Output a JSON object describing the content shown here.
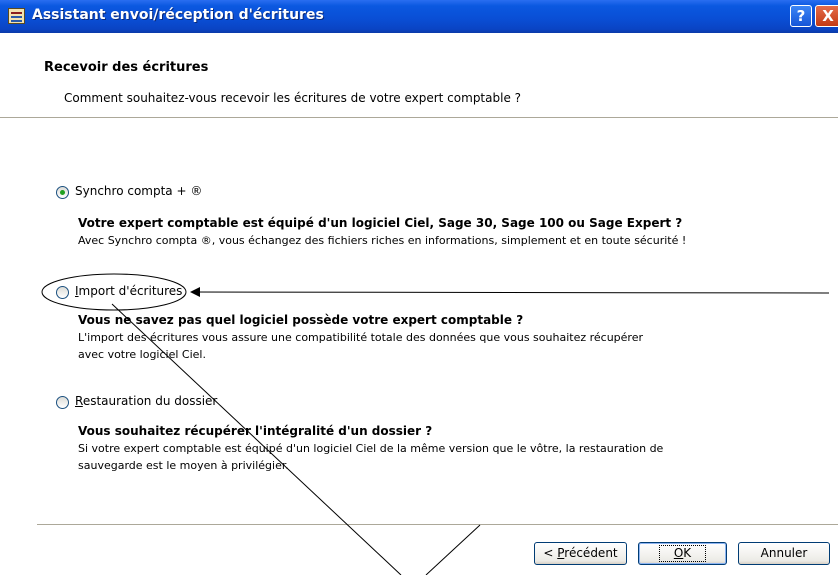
{
  "window": {
    "title": "Assistant envoi/réception d'écritures",
    "help_glyph": "?",
    "close_glyph": "X",
    "app_icon": "ledger-icon"
  },
  "header": {
    "title": "Recevoir des écritures",
    "subtitle": "Comment souhaitez-vous recevoir les écritures de votre expert comptable ?"
  },
  "options": [
    {
      "label": "Synchro compta + ®",
      "checked": true,
      "bold": "Votre expert comptable est équipé d'un logiciel Ciel, Sage 30, Sage 100 ou Sage Expert ?",
      "desc": [
        "Avec Synchro compta ®, vous échangez des fichiers riches en informations, simplement et en toute sécurité !"
      ]
    },
    {
      "label_pre": "",
      "label_accel": "I",
      "label_post": "mport d'écritures",
      "checked": false,
      "bold": "Vous ne savez pas quel logiciel possède votre expert comptable ?",
      "desc": [
        "L'import des écritures vous assure une compatibilité totale des données que vous souhaitez récupérer",
        "avec votre logiciel Ciel."
      ]
    },
    {
      "label_pre": "",
      "label_accel": "R",
      "label_post": "estauration du dossier",
      "checked": false,
      "bold": "Vous souhaitez récupérer l'intégralité d'un dossier ?",
      "desc": [
        "Si votre expert comptable est équipé d'un logiciel Ciel de la même version que le vôtre, la restauration de",
        "sauvegarde est le moyen à privilégier."
      ]
    }
  ],
  "buttons": {
    "prev_pre": "< ",
    "prev_accel": "P",
    "prev_post": "récédent",
    "ok_accel": "O",
    "ok_post": "K",
    "cancel": "Annuler"
  },
  "colors": {
    "titlebar": "#0a4fd6",
    "radio_dot": "#21a121",
    "annotation": "#000000"
  }
}
